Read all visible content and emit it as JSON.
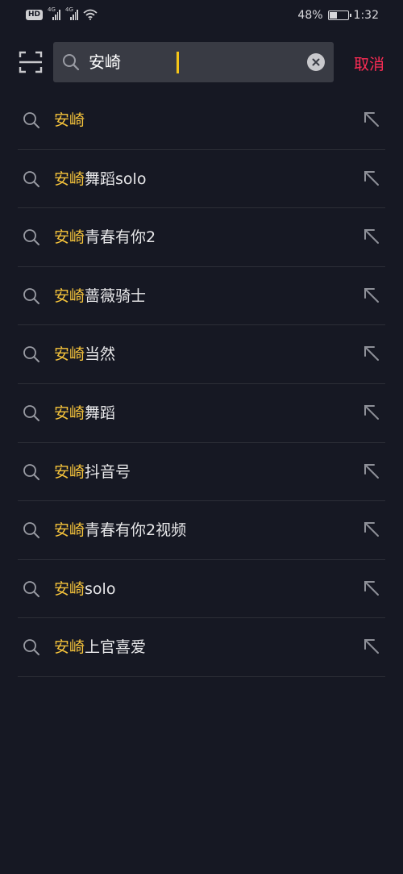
{
  "status_bar": {
    "hd_label": "HD",
    "network_1": "4G",
    "network_2": "4G",
    "battery_percent": "48%",
    "battery_level": 0.48,
    "time": "1:32"
  },
  "search": {
    "query": "安崎",
    "cancel_label": "取消",
    "icons": {
      "scan": "scan-icon",
      "search": "search-icon",
      "clear": "clear-icon"
    }
  },
  "colors": {
    "background": "#161823",
    "search_box": "#393b44",
    "highlight": "#f5c33b",
    "cancel": "#fe2c55",
    "caret": "#f5c518"
  },
  "suggestions": [
    {
      "highlight": "安崎",
      "rest": ""
    },
    {
      "highlight": "安崎",
      "rest": "舞蹈solo"
    },
    {
      "highlight": "安崎",
      "rest": "青春有你2"
    },
    {
      "highlight": "安崎",
      "rest": "蔷薇骑士"
    },
    {
      "highlight": "安崎",
      "rest": "当然"
    },
    {
      "highlight": "安崎",
      "rest": "舞蹈"
    },
    {
      "highlight": "安崎",
      "rest": "抖音号"
    },
    {
      "highlight": "安崎",
      "rest": "青春有你2视频"
    },
    {
      "highlight": "安崎",
      "rest": "solo"
    },
    {
      "highlight": "安崎",
      "rest": "上官喜爱"
    }
  ]
}
